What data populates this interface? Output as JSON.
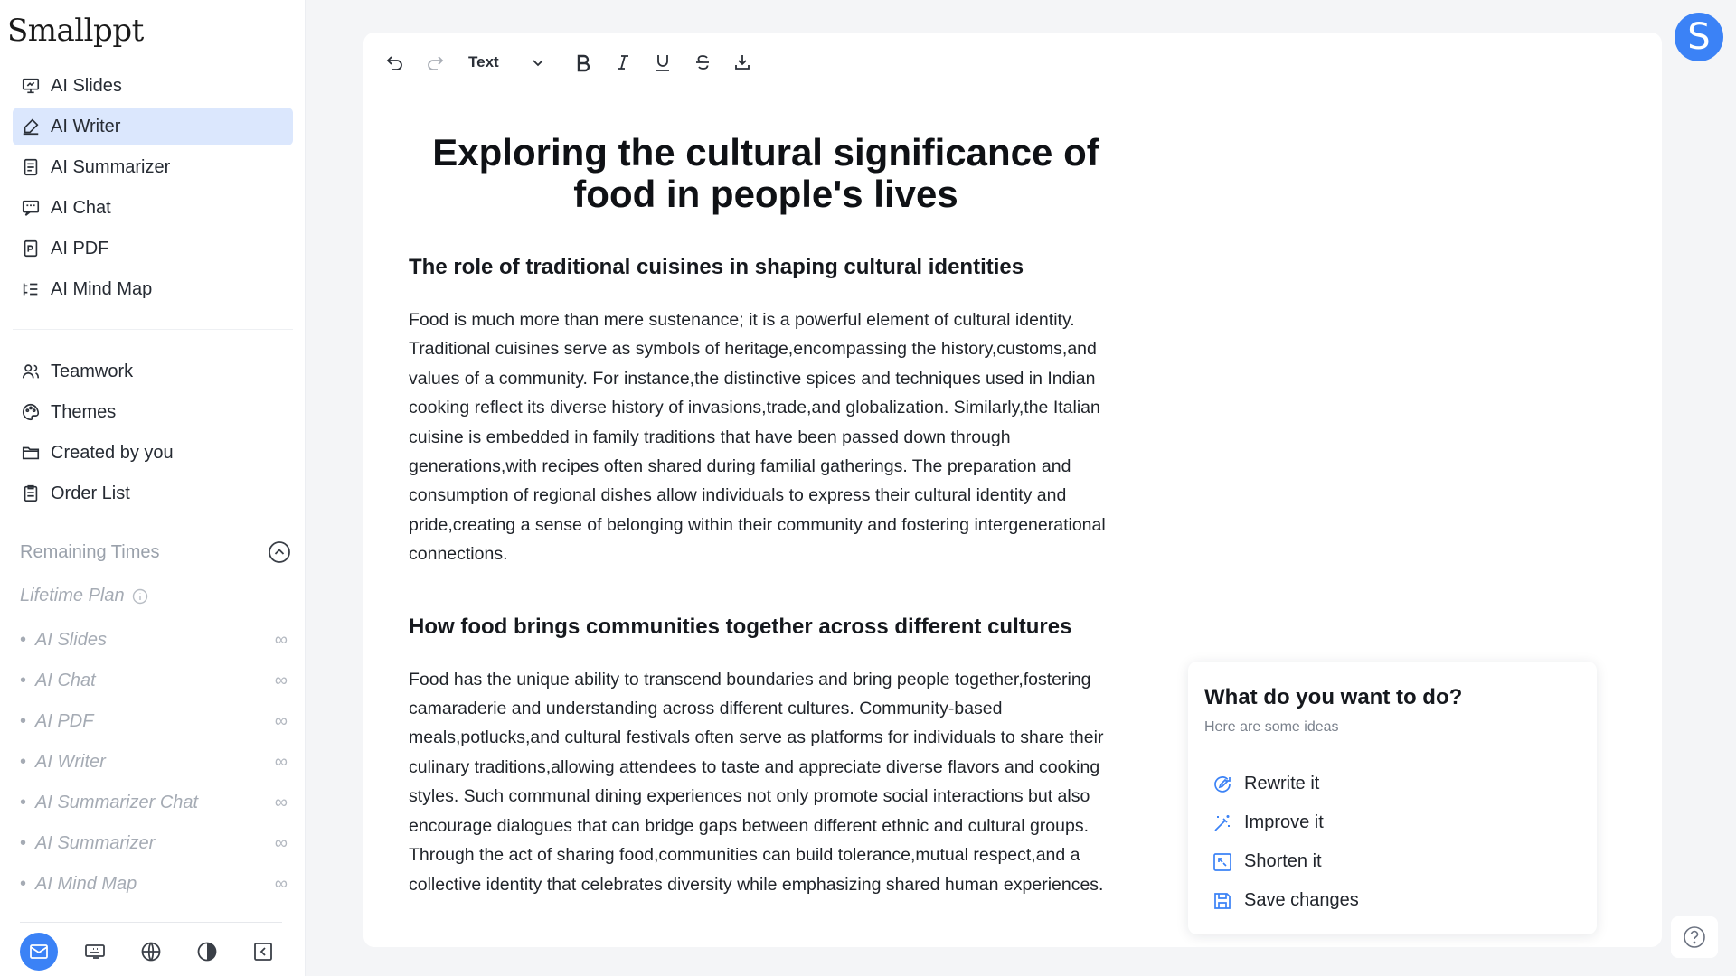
{
  "app": {
    "logo": "Smallppt"
  },
  "sidebar": {
    "nav": [
      {
        "label": "AI Slides",
        "icon": "presentation-icon"
      },
      {
        "label": "AI Writer",
        "icon": "writer-icon",
        "active": true
      },
      {
        "label": "AI Summarizer",
        "icon": "summary-doc-icon"
      },
      {
        "label": "AI Chat",
        "icon": "chat-icon"
      },
      {
        "label": "AI PDF",
        "icon": "pdf-icon"
      },
      {
        "label": "AI Mind Map",
        "icon": "mindmap-icon"
      }
    ],
    "nav2": [
      {
        "label": "Teamwork",
        "icon": "team-icon"
      },
      {
        "label": "Themes",
        "icon": "palette-icon"
      },
      {
        "label": "Created by you",
        "icon": "folder-icon"
      },
      {
        "label": "Order List",
        "icon": "clipboard-icon"
      }
    ],
    "remaining_label": "Remaining Times",
    "plan_label": "Lifetime Plan",
    "quota": [
      {
        "label": "AI Slides",
        "value": "∞"
      },
      {
        "label": "AI Chat",
        "value": "∞"
      },
      {
        "label": "AI PDF",
        "value": "∞"
      },
      {
        "label": "AI Writer",
        "value": "∞"
      },
      {
        "label": "AI Summarizer Chat",
        "value": "∞"
      },
      {
        "label": "AI Summarizer",
        "value": "∞"
      },
      {
        "label": "AI Mind Map",
        "value": "∞"
      }
    ]
  },
  "toolbar": {
    "text_style": "Text"
  },
  "document": {
    "title": "Exploring the cultural significance of food in people's lives",
    "sections": [
      {
        "heading": "The role of traditional cuisines in shaping cultural identities",
        "body": "Food is much more than mere sustenance; it is a powerful element of cultural identity. Traditional cuisines serve as symbols of heritage,encompassing the history,customs,and values of a community. For instance,the distinctive spices and techniques used in Indian cooking reflect its diverse history of invasions,trade,and globalization. Similarly,the Italian cuisine is embedded in family traditions that have been passed down through generations,with recipes often shared during familial gatherings. The preparation and consumption of regional dishes allow individuals to express their cultural identity and pride,creating a sense of belonging within their community and fostering intergenerational connections."
      },
      {
        "heading": "How food brings communities together across different cultures",
        "body": "Food has the unique ability to transcend boundaries and bring people together,fostering camaraderie and understanding across different cultures. Community-based meals,potlucks,and cultural festivals often serve as platforms for individuals to share their culinary traditions,allowing attendees to taste and appreciate diverse flavors and cooking styles. Such communal dining experiences not only promote social interactions but also encourage dialogues that can bridge gaps between different ethnic and cultural groups. Through the act of sharing food,communities can build tolerance,mutual respect,and a collective identity that celebrates diversity while emphasizing shared human experiences."
      }
    ]
  },
  "panel": {
    "title": "What do you want to do?",
    "subtitle": "Here are some ideas",
    "actions": [
      {
        "label": "Rewrite it"
      },
      {
        "label": "Improve it"
      },
      {
        "label": "Shorten it"
      },
      {
        "label": "Save changes"
      }
    ]
  },
  "user": {
    "avatar_letter": "S"
  },
  "colors": {
    "accent": "#3b82f6",
    "active_bg": "#dbe7fd",
    "muted": "#a5abb4"
  }
}
